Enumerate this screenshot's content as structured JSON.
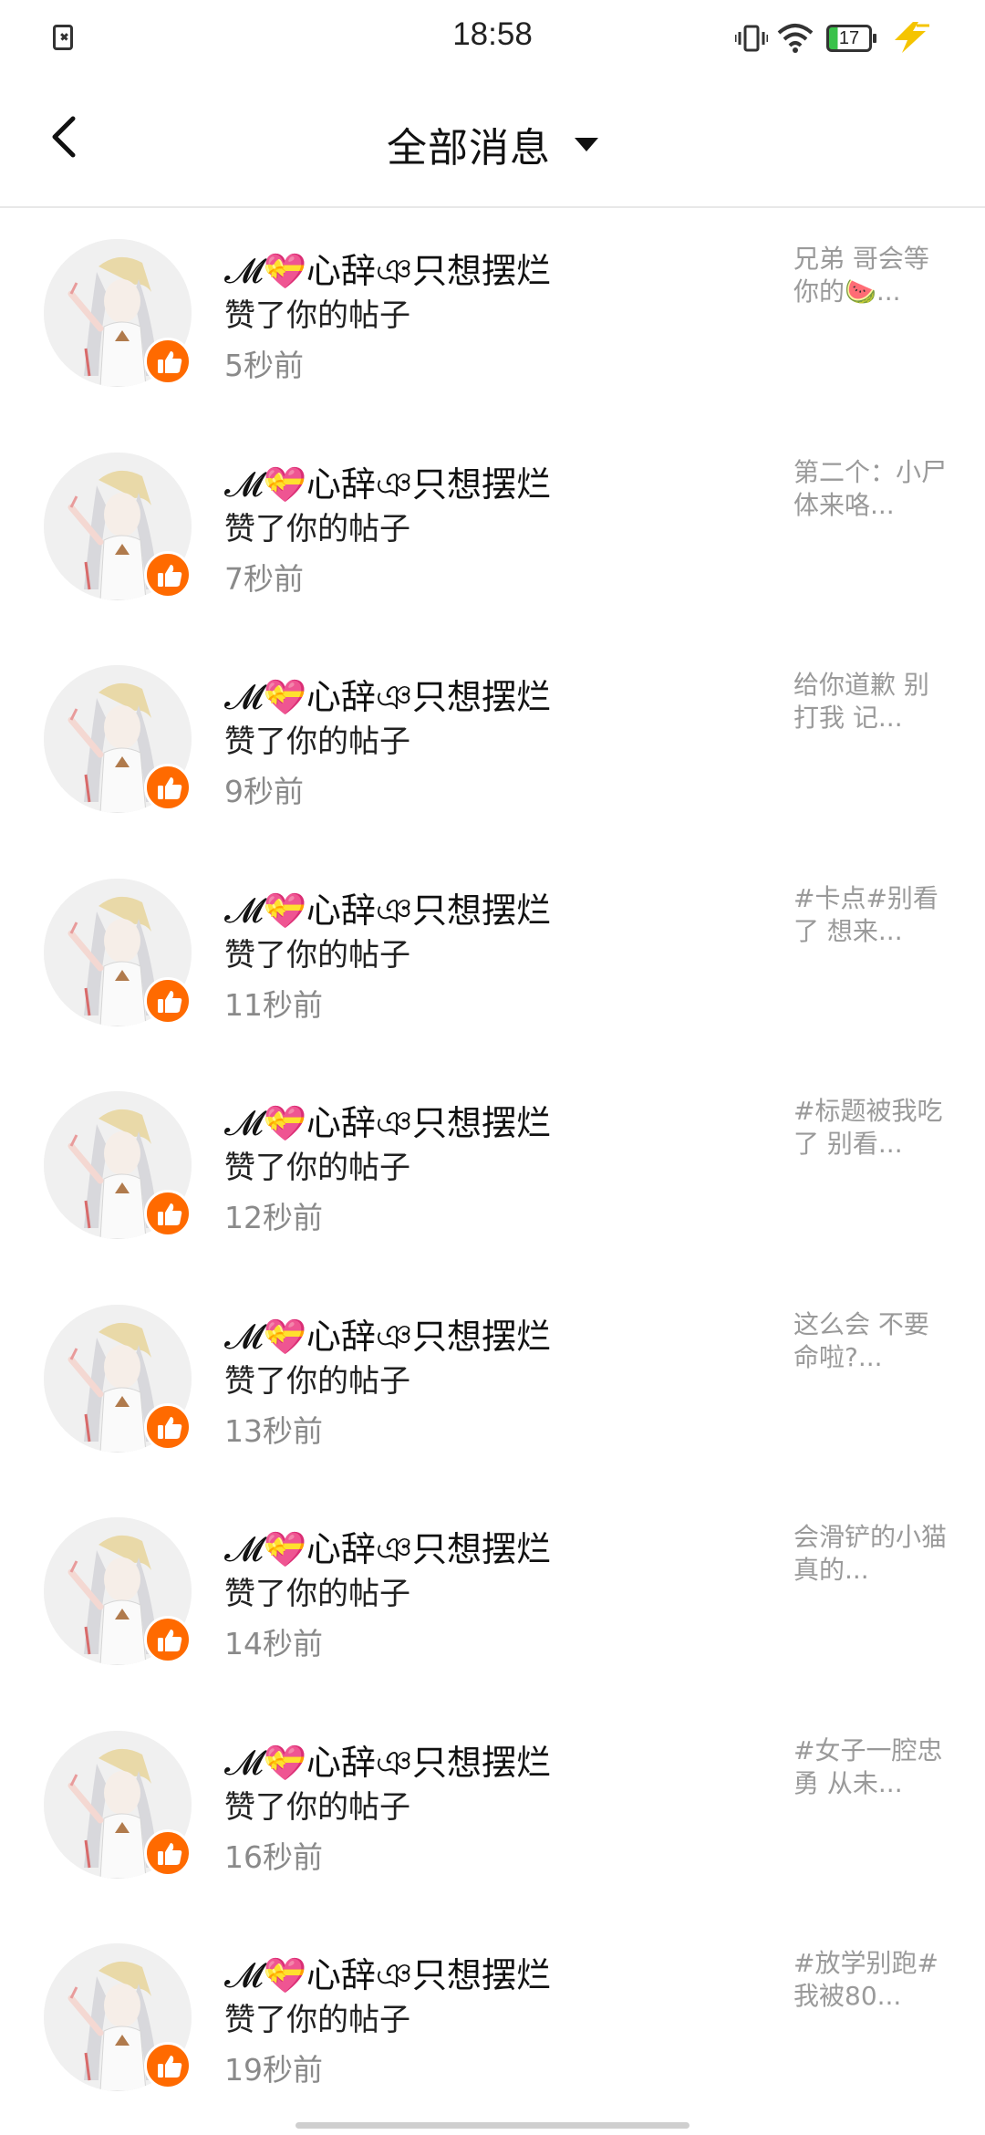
{
  "status_bar": {
    "time": "18:58",
    "battery": "17",
    "left_icon": "sim-error-icon",
    "icons": [
      "vibrate-icon",
      "wifi-icon",
      "battery-icon",
      "charging-icon"
    ]
  },
  "header": {
    "title": "全部消息",
    "back_icon": "chevron-left-icon",
    "dropdown_icon": "caret-down-icon"
  },
  "colors": {
    "like_badge": "#ff6a00",
    "secondary_text": "#8a8a8a",
    "preview_text": "#9a9a9a"
  },
  "notifications": [
    {
      "user": "𝓜💝心辞ঞ只想摆烂",
      "action": "赞了你的帖子",
      "time": "5秒前",
      "preview": "兄弟 哥会等你的🍉..."
    },
    {
      "user": "𝓜💝心辞ঞ只想摆烂",
      "action": "赞了你的帖子",
      "time": "7秒前",
      "preview": "第二个：小尸体来咯..."
    },
    {
      "user": "𝓜💝心辞ঞ只想摆烂",
      "action": "赞了你的帖子",
      "time": "9秒前",
      "preview": "给你道歉 别打我 记..."
    },
    {
      "user": "𝓜💝心辞ঞ只想摆烂",
      "action": "赞了你的帖子",
      "time": "11秒前",
      "preview": "#卡点#别看了 想来..."
    },
    {
      "user": "𝓜💝心辞ঞ只想摆烂",
      "action": "赞了你的帖子",
      "time": "12秒前",
      "preview": "#标题被我吃了 别看..."
    },
    {
      "user": "𝓜💝心辞ঞ只想摆烂",
      "action": "赞了你的帖子",
      "time": "13秒前",
      "preview": "这么会 不要命啦?..."
    },
    {
      "user": "𝓜💝心辞ঞ只想摆烂",
      "action": "赞了你的帖子",
      "time": "14秒前",
      "preview": "会滑铲的小猫 真的..."
    },
    {
      "user": "𝓜💝心辞ঞ只想摆烂",
      "action": "赞了你的帖子",
      "time": "16秒前",
      "preview": "#女子一腔忠勇 从未..."
    },
    {
      "user": "𝓜💝心辞ঞ只想摆烂",
      "action": "赞了你的帖子",
      "time": "19秒前",
      "preview": "#放学别跑#我被80..."
    }
  ]
}
